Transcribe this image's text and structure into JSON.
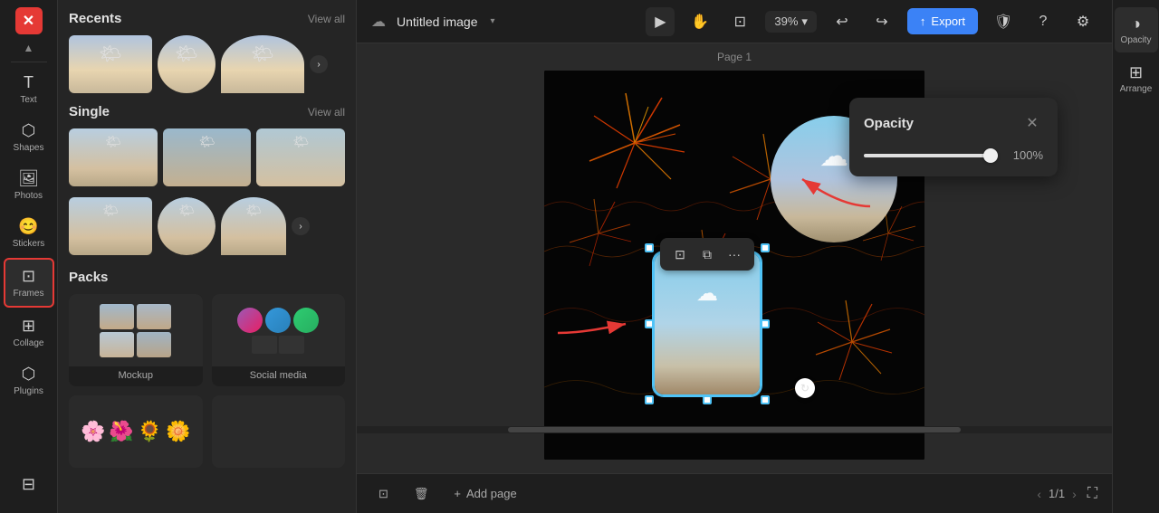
{
  "app": {
    "logo": "✕",
    "title": "Untitled image",
    "title_chevron": "▾"
  },
  "toolbar": {
    "cloud_icon": "☁",
    "select_icon": "▶",
    "hand_icon": "✋",
    "frame_icon": "⊡",
    "zoom_value": "39%",
    "zoom_chevron": "▾",
    "undo_icon": "↩",
    "redo_icon": "↪",
    "export_label": "Export",
    "export_icon": "↑",
    "shield_icon": "🛡",
    "help_icon": "?",
    "settings_icon": "⚙"
  },
  "tools": [
    {
      "id": "text",
      "icon": "T",
      "label": "Text"
    },
    {
      "id": "shapes",
      "icon": "◯",
      "label": "Shapes"
    },
    {
      "id": "photos",
      "icon": "🖼",
      "label": "Photos"
    },
    {
      "id": "stickers",
      "icon": "😊",
      "label": "Stickers"
    },
    {
      "id": "frames",
      "icon": "⊡",
      "label": "Frames",
      "active": true
    },
    {
      "id": "collage",
      "icon": "⊞",
      "label": "Collage"
    },
    {
      "id": "plugins",
      "icon": "🔌",
      "label": "Plugins"
    }
  ],
  "elements_panel": {
    "recents_title": "Recents",
    "recents_view_all": "View all",
    "single_title": "Single",
    "single_view_all": "View all",
    "packs_title": "Packs",
    "pack1_label": "Mockup",
    "pack2_label": "Social media"
  },
  "canvas": {
    "page_label": "Page 1"
  },
  "context_menu": {
    "btn1_icon": "⊡",
    "btn2_icon": "⧉",
    "btn3_icon": "•••"
  },
  "bottom_toolbar": {
    "add_page_icon": "+",
    "add_page_label": "Add page",
    "page_current": "1/1"
  },
  "opacity_panel": {
    "title": "Opacity",
    "close_icon": "✕",
    "value": "100%",
    "slider_pct": 100
  },
  "right_panel": {
    "opacity_icon": "◑",
    "opacity_label": "Opacity",
    "arrange_icon": "⊞",
    "arrange_label": "Arrange"
  }
}
